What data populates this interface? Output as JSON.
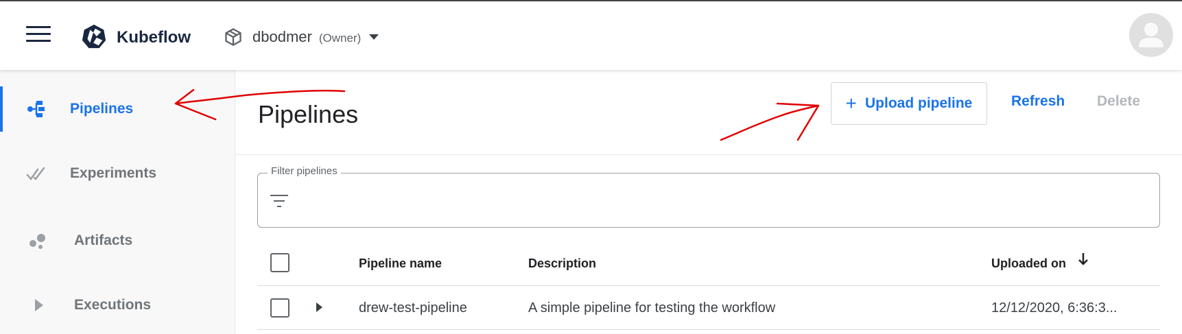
{
  "app": {
    "logo_text": "Kubeflow",
    "namespace": {
      "name": "dbodmer",
      "role": "(Owner)"
    }
  },
  "sidebar": {
    "items": [
      {
        "label": "Pipelines",
        "icon": "pipelines-icon",
        "active": true
      },
      {
        "label": "Experiments",
        "icon": "experiments-icon",
        "active": false
      },
      {
        "label": "Artifacts",
        "icon": "artifacts-icon",
        "active": false
      },
      {
        "label": "Executions",
        "icon": "executions-icon",
        "active": false
      }
    ]
  },
  "page": {
    "title": "Pipelines",
    "toolbar": {
      "upload_label": "Upload pipeline",
      "refresh_label": "Refresh",
      "delete_label": "Delete"
    }
  },
  "filter": {
    "label": "Filter pipelines",
    "value": ""
  },
  "table": {
    "columns": [
      "Pipeline name",
      "Description",
      "Uploaded on"
    ],
    "rows": [
      {
        "name": "drew-test-pipeline",
        "description": "A simple pipeline for testing the workflow",
        "uploaded_on": "12/12/2020, 6:36:3..."
      }
    ]
  },
  "colors": {
    "accent": "#1a73e8",
    "brand_dark": "#1a2740",
    "annotation": "#e00000",
    "disabled": "#b4b8bd"
  }
}
